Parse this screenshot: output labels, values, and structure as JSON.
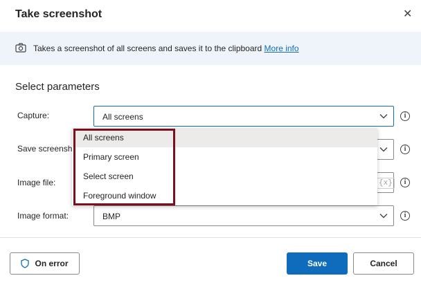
{
  "dialog": {
    "title": "Take screenshot",
    "close_icon": "close-icon"
  },
  "info": {
    "icon": "camera-icon",
    "text": "Takes a screenshot of all screens and saves it to the clipboard",
    "link": "More info"
  },
  "section_title": "Select parameters",
  "fields": {
    "capture": {
      "label": "Capture:",
      "value": "All screens"
    },
    "save_to": {
      "label": "Save screenshot to:",
      "value": ""
    },
    "image_file": {
      "label": "Image file:",
      "value": "",
      "var_button": "{x}"
    },
    "image_format": {
      "label": "Image format:",
      "value": "BMP"
    }
  },
  "dropdown": {
    "options": [
      "All screens",
      "Primary screen",
      "Select screen",
      "Foreground window"
    ],
    "selected_index": 0
  },
  "footer": {
    "on_error": "On error",
    "save": "Save",
    "cancel": "Cancel"
  },
  "colors": {
    "accent": "#0f6cbd",
    "highlight_border": "#7a0f1e",
    "info_bar": "#eff4fb"
  }
}
